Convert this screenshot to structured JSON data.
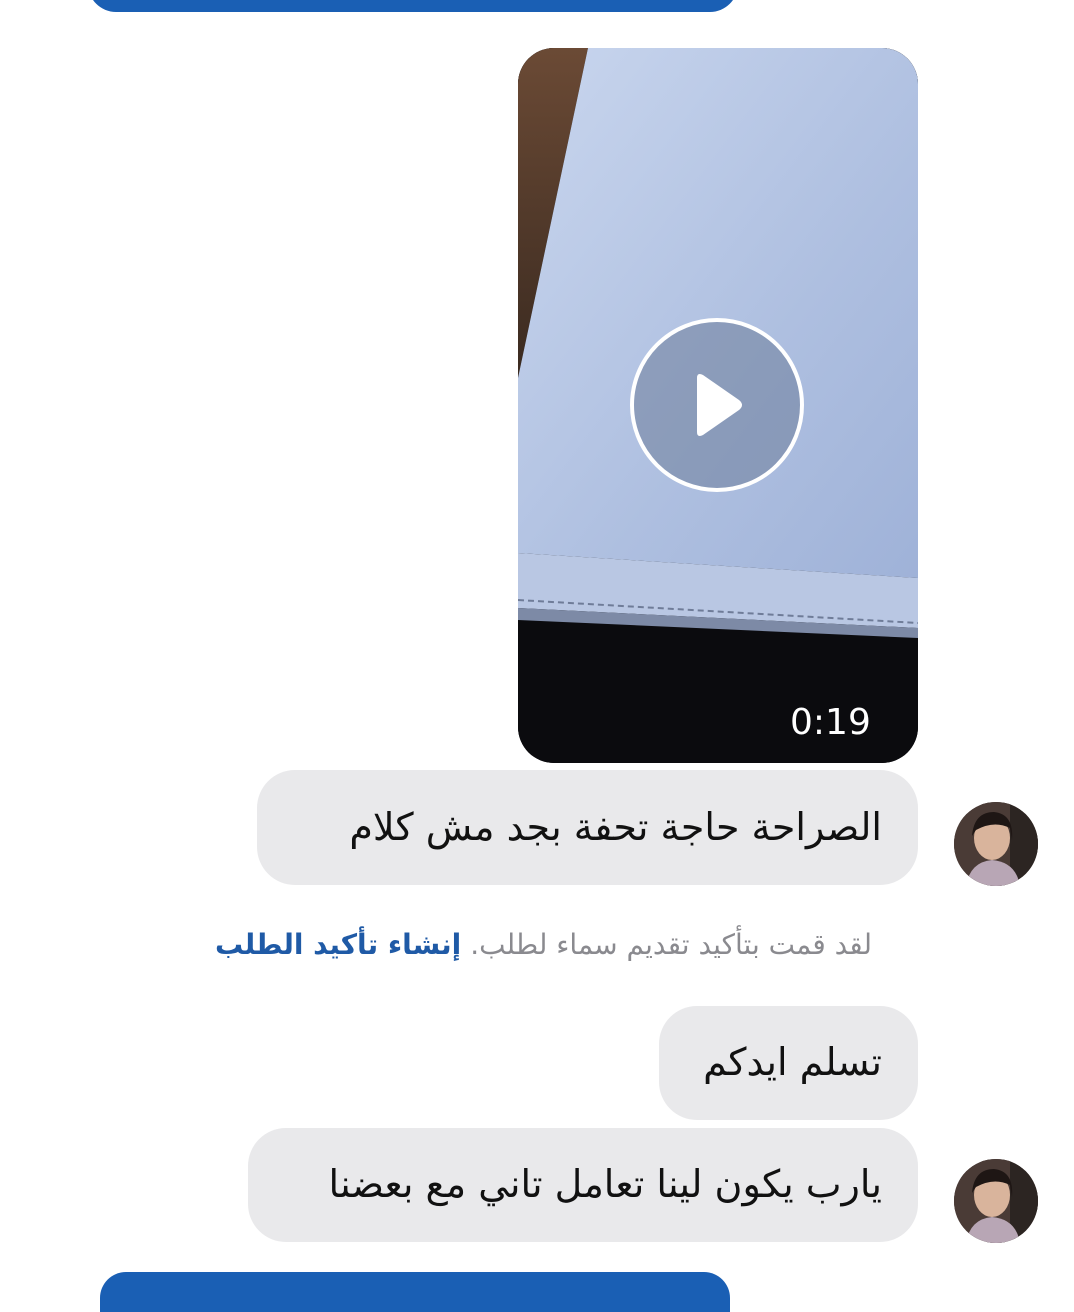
{
  "video": {
    "duration": "0:19",
    "play_icon": "play-icon"
  },
  "messages": [
    {
      "text": "الصراحة حاجة تحفة بجد مش كلام",
      "sender": "contact"
    },
    {
      "text": "تسلم ايدكم",
      "sender": "contact"
    },
    {
      "text": "يارب يكون لينا تعامل تاني مع بعضنا",
      "sender": "contact"
    }
  ],
  "system_note": {
    "text": "لقد قمت بتأكيد تقديم سماء لطلب.",
    "link_label": "إنشاء تأكيد الطلب"
  },
  "colors": {
    "accent": "#1a5fb4",
    "bubble": "#e9e9eb",
    "link": "#1f5aa6",
    "muted_text": "#8a8a8f"
  }
}
